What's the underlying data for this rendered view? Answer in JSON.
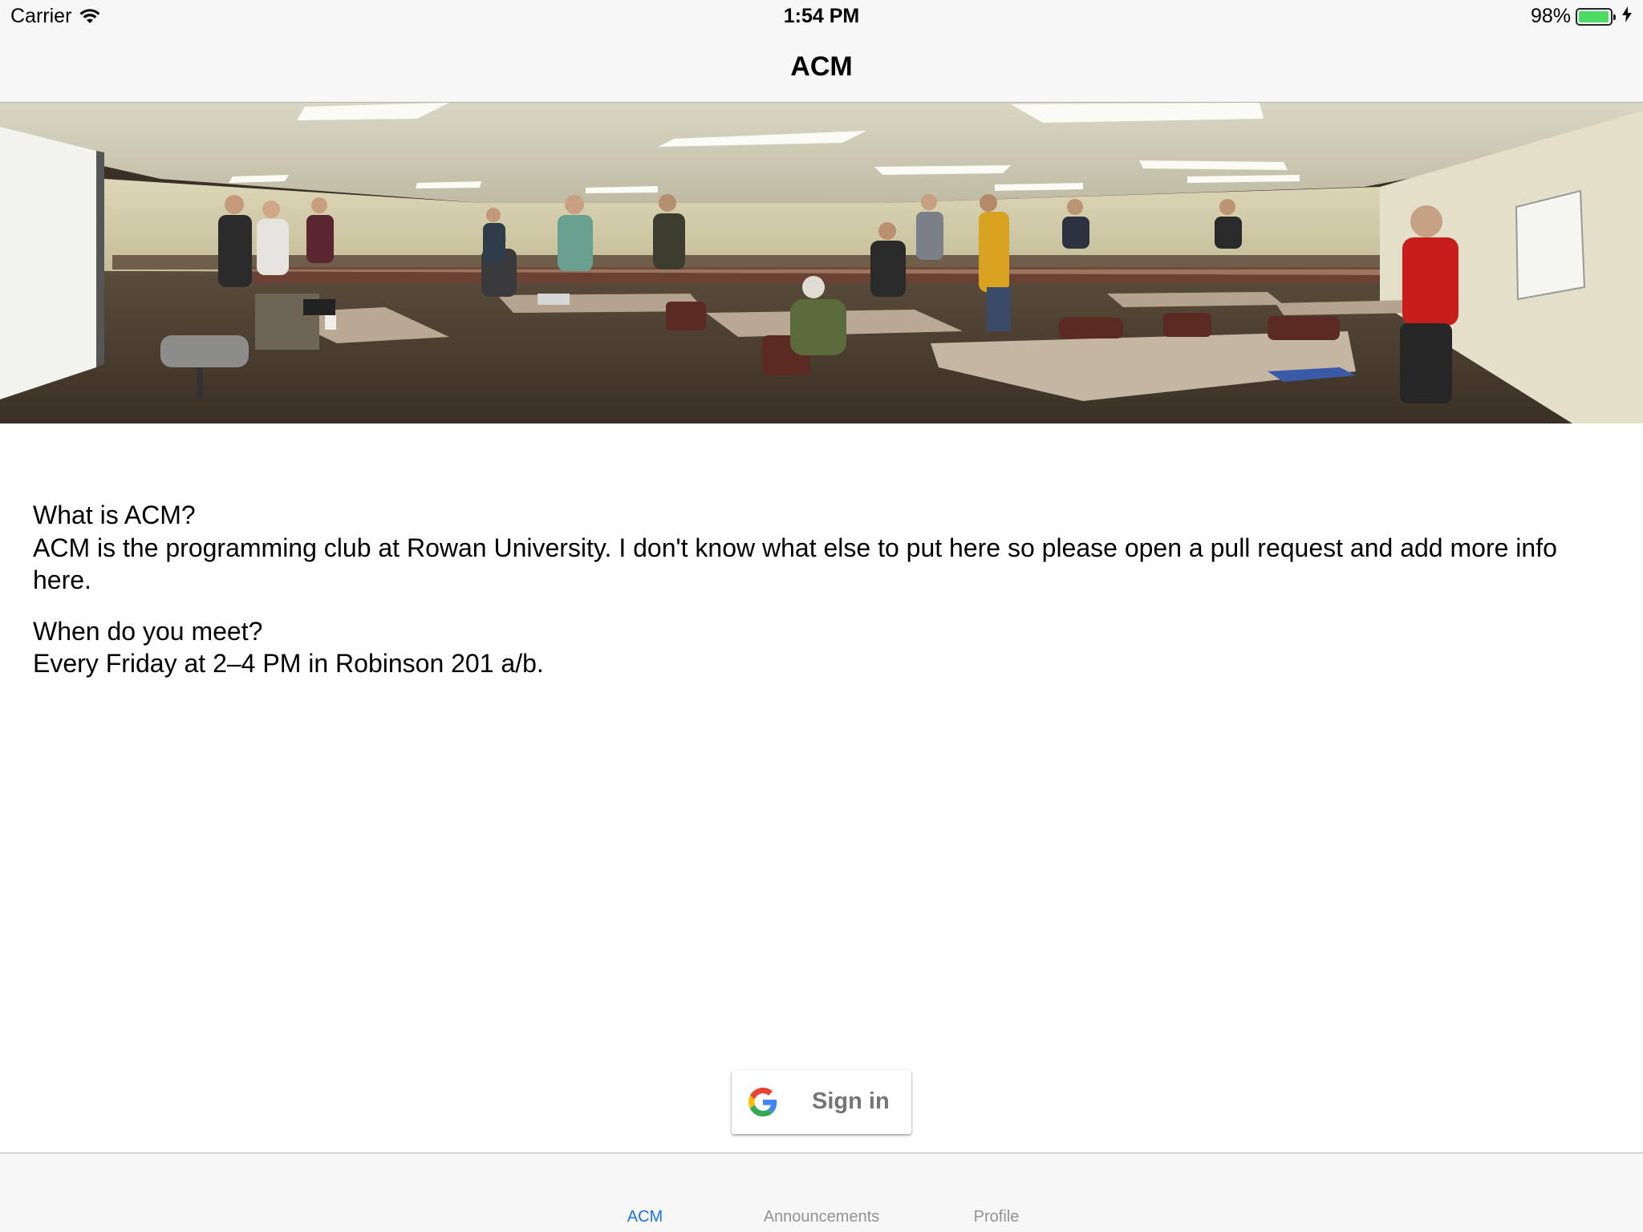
{
  "status_bar": {
    "carrier": "Carrier",
    "time": "1:54 PM",
    "battery_percent": "98%",
    "battery_level": 0.98,
    "icons": [
      "wifi-icon",
      "battery-icon",
      "charging-bolt-icon"
    ]
  },
  "nav": {
    "title": "ACM"
  },
  "hero": {
    "icon": "classroom-photo"
  },
  "content": {
    "q1": "What is ACM?",
    "a1": "ACM is the programming club at Rowan University. I don't know what else to put here so please open a pull request and add more info here.",
    "q2": "When do you meet?",
    "a2": "Every Friday at 2–4 PM in Robinson 201 a/b."
  },
  "signin": {
    "label": "Sign in",
    "icon": "google-g-icon"
  },
  "tabs": [
    {
      "label": "ACM",
      "active": true
    },
    {
      "label": "Announcements",
      "active": false
    },
    {
      "label": "Profile",
      "active": false
    }
  ],
  "colors": {
    "accent": "#1a73e8",
    "bar_background": "#f7f7f7",
    "battery": "#4cd964",
    "inactive_tab": "#929292"
  }
}
